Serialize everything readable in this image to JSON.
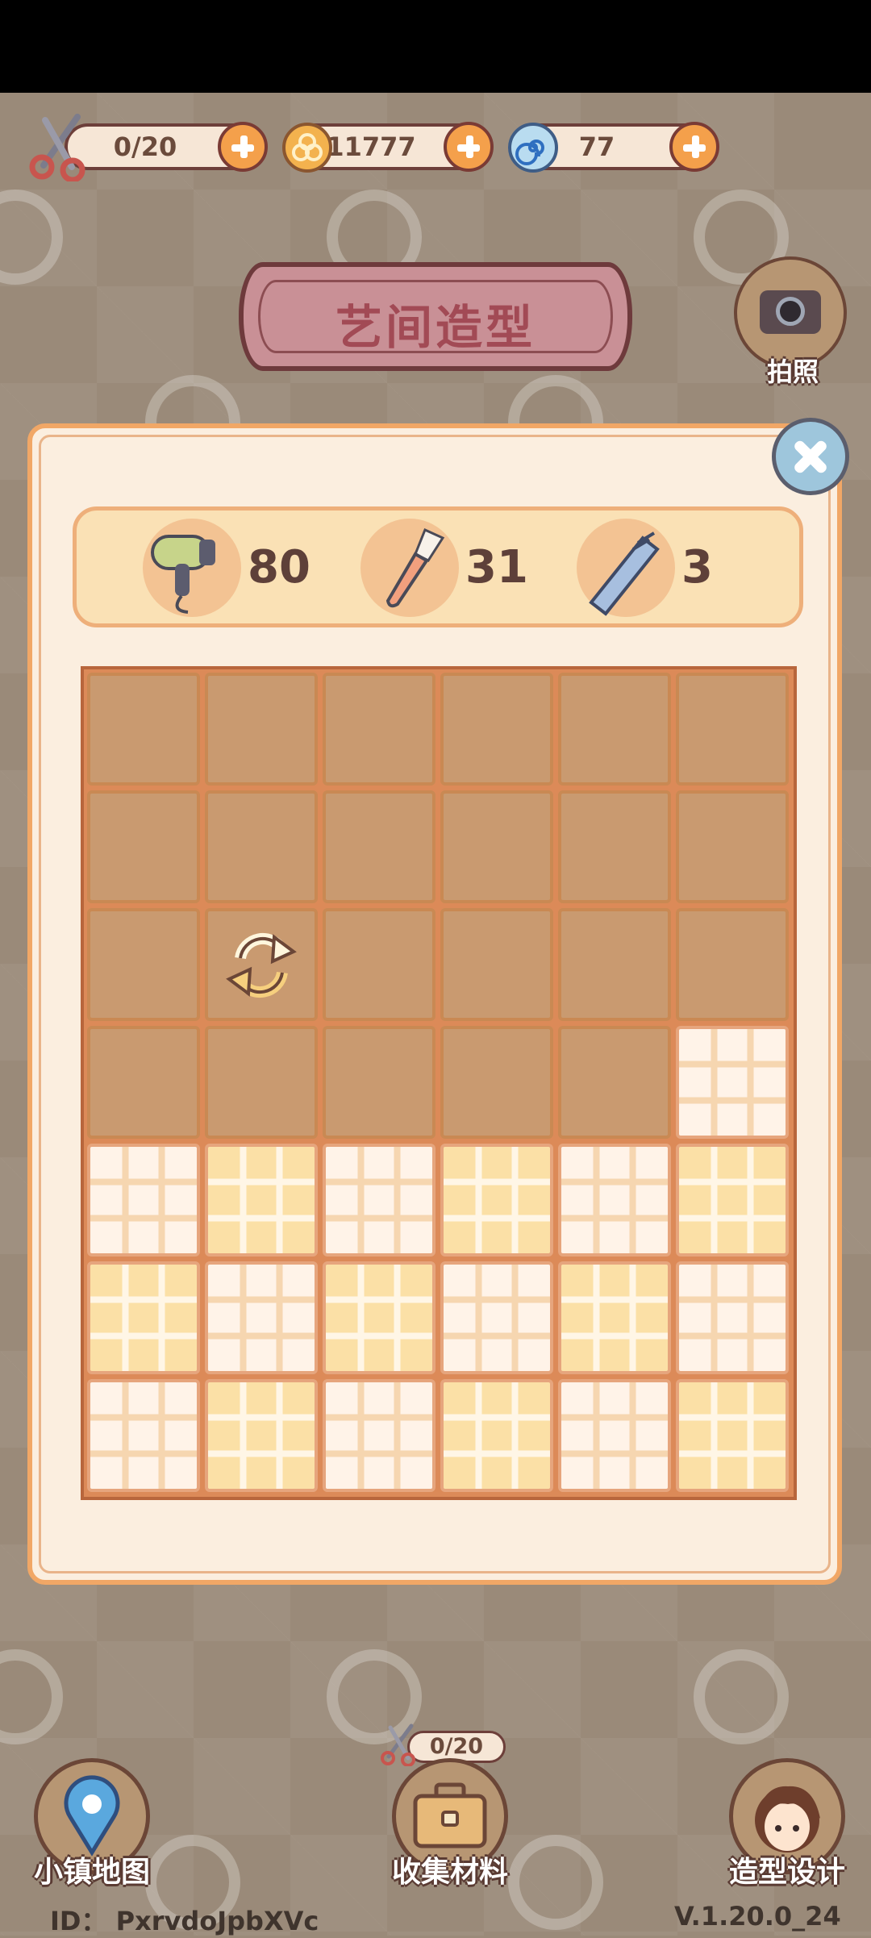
{
  "resources": {
    "scissors": {
      "value": "0/20",
      "icon": "scissors-icon"
    },
    "coins": {
      "value": "11777",
      "icon": "coin-icon"
    },
    "gems": {
      "value": "77",
      "icon": "swirl-gem-icon"
    }
  },
  "title": "艺间造型",
  "camera": {
    "label": "拍照",
    "icon": "camera-icon"
  },
  "tools": [
    {
      "name": "hair-dryer",
      "icon": "hair-dryer-icon",
      "count": "80"
    },
    {
      "name": "makeup-brush",
      "icon": "makeup-brush-icon",
      "count": "31"
    },
    {
      "name": "comb",
      "icon": "comb-icon",
      "count": "3"
    }
  ],
  "grid": {
    "rows": 7,
    "cols": 6,
    "cells": [
      [
        "dark",
        "dark",
        "dark",
        "dark",
        "dark",
        "dark"
      ],
      [
        "dark",
        "dark",
        "dark",
        "dark",
        "dark",
        "dark"
      ],
      [
        "dark",
        "refresh",
        "dark",
        "dark",
        "dark",
        "dark"
      ],
      [
        "dark",
        "dark",
        "dark",
        "dark",
        "dark",
        "plaid"
      ],
      [
        "plaid",
        "plaid",
        "plaid",
        "plaid",
        "plaid",
        "plaid"
      ],
      [
        "plaid",
        "plaid",
        "plaid",
        "plaid",
        "plaid",
        "plaid"
      ],
      [
        "plaid",
        "plaid",
        "plaid",
        "plaid",
        "plaid",
        "plaid"
      ]
    ]
  },
  "stamina": "0/20",
  "nav": {
    "map": "小镇地图",
    "collect": "收集材料",
    "design": "造型设计"
  },
  "footer": {
    "id": "ID： PxrvdoJpbXVc",
    "version": "V.1.20.0_24"
  },
  "colors": {
    "panel": "#fbeedf",
    "accent": "#f4a04b",
    "outline": "#6d3f3a"
  }
}
